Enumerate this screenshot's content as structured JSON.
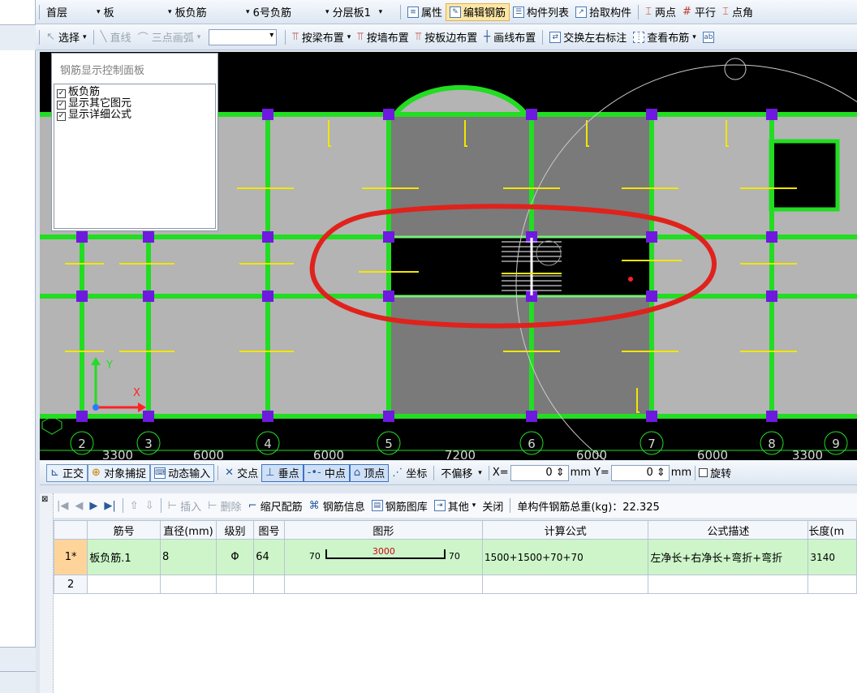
{
  "toolbar1": {
    "floor": "首层",
    "type": "板",
    "subtype": "板负筋",
    "name": "6号负筋",
    "slab": "分层板1",
    "btn_props": "属性",
    "btn_edit_rebar": "编辑钢筋",
    "btn_list": "构件列表",
    "btn_pick": "拾取构件",
    "btn_two_pts": "两点",
    "btn_parallel": "平行",
    "btn_pt_angle": "点角"
  },
  "toolbar2": {
    "select": "选择",
    "line": "直线",
    "arc": "三点画弧",
    "by_beam": "按梁布置",
    "by_wall": "按墙布置",
    "by_slab_edge": "按板边布置",
    "draw_line": "画线布置",
    "swap_label": "交换左右标注",
    "view_rebar": "查看布筋"
  },
  "panel": {
    "title": "钢筋显示控制面板",
    "items": [
      "板负筋",
      "显示其它图元",
      "显示详细公式"
    ]
  },
  "axes": {
    "labels": [
      "2",
      "3",
      "4",
      "5",
      "6",
      "7",
      "8",
      "9"
    ],
    "dims": [
      "3300",
      "6000",
      "6000",
      "7200",
      "6000",
      "6000",
      "3300"
    ],
    "y_label": "Y",
    "x_label": "X"
  },
  "snap": {
    "ortho": "正交",
    "obj_snap": "对象捕捉",
    "dyn_input": "动态输入",
    "intersect": "交点",
    "perp": "垂点",
    "mid": "中点",
    "vertex": "顶点",
    "coord": "坐标",
    "offset_mode": "不偏移",
    "x_label": "X=",
    "x_value": "0",
    "mm1": "mm",
    "y_label": "Y=",
    "y_value": "0",
    "mm2": "mm",
    "rotate": "旋转"
  },
  "rebar_toolbar": {
    "insert": "插入",
    "delete": "删除",
    "scale": "缩尺配筋",
    "info": "钢筋信息",
    "library": "钢筋图库",
    "other": "其他",
    "close": "关闭",
    "total_weight": "单构件钢筋总重(kg)：22.325"
  },
  "table": {
    "headers": [
      "筋号",
      "直径(mm)",
      "级别",
      "图号",
      "图形",
      "计算公式",
      "公式描述",
      "长度(m"
    ],
    "rows": [
      {
        "idx": "1*",
        "name": "板负筋.1",
        "dia": "8",
        "grade": "Φ",
        "fig": "64",
        "shape_left": "70",
        "shape_mid": "3000",
        "shape_right": "70",
        "formula": "1500+1500+70+70",
        "desc": "左净长+右净长+弯折+弯折",
        "length": "3140"
      },
      {
        "idx": "2",
        "name": "",
        "dia": "",
        "grade": "",
        "fig": "",
        "shape_left": "",
        "shape_mid": "",
        "shape_right": "",
        "formula": "",
        "desc": "",
        "length": ""
      }
    ]
  }
}
